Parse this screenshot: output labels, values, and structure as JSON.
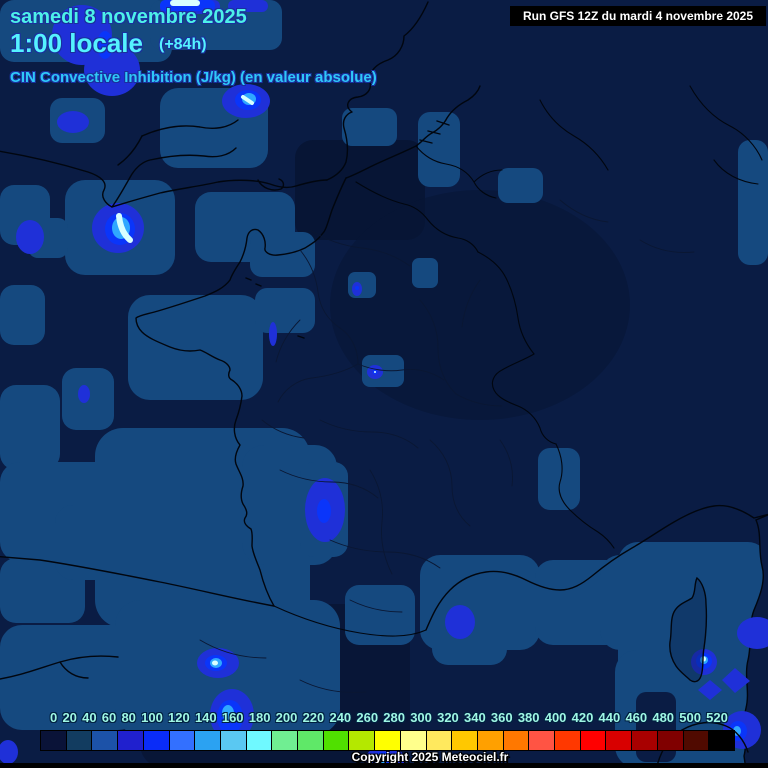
{
  "header": {
    "date_line": "samedi 8 novembre 2025",
    "time_line": "1:00 locale",
    "forecast_offset": "(+84h)",
    "run_info": "Run GFS 12Z du mardi 4 novembre 2025",
    "parameter_title": "CIN Convective Inhibition (J/kg) (en valeur absolue)"
  },
  "footer": {
    "copyright": "Copyright 2025 Meteociel.fr"
  },
  "colorbar": {
    "labels": [
      "0",
      "20",
      "40",
      "60",
      "80",
      "100",
      "120",
      "140",
      "160",
      "180",
      "200",
      "220",
      "240",
      "260",
      "280",
      "300",
      "320",
      "340",
      "360",
      "380",
      "400",
      "420",
      "440",
      "460",
      "480",
      "500",
      "520"
    ],
    "colors": [
      "#0a1338",
      "#123c60",
      "#1c52a8",
      "#2020ce",
      "#0a2cf8",
      "#3370ff",
      "#2ba2f2",
      "#5ac8f2",
      "#6ff9ff",
      "#70ee92",
      "#5fe868",
      "#50e000",
      "#b4e800",
      "#ffff00",
      "#ffff8c",
      "#ffe95e",
      "#ffc800",
      "#ffa000",
      "#ff7800",
      "#ff5444",
      "#ff3800",
      "#ff0000",
      "#d80000",
      "#a80000",
      "#800000",
      "#500a00",
      "#000000"
    ],
    "unit": "J/kg"
  },
  "palette": {
    "base": "#0a1c44",
    "patch": "#15497f",
    "dark": "#071535",
    "royal": "#1f30d8",
    "bright": "#0a35fa",
    "light": "#2fa8ff",
    "core": "#d8ffff",
    "coast": "#01060f",
    "dept": "#0a1733",
    "title": "#4df0e8",
    "time": "#55f2ff",
    "cin": "#2fc8f8",
    "scale-label": "#9ff7e4",
    "outline": "#1a2f9e"
  }
}
